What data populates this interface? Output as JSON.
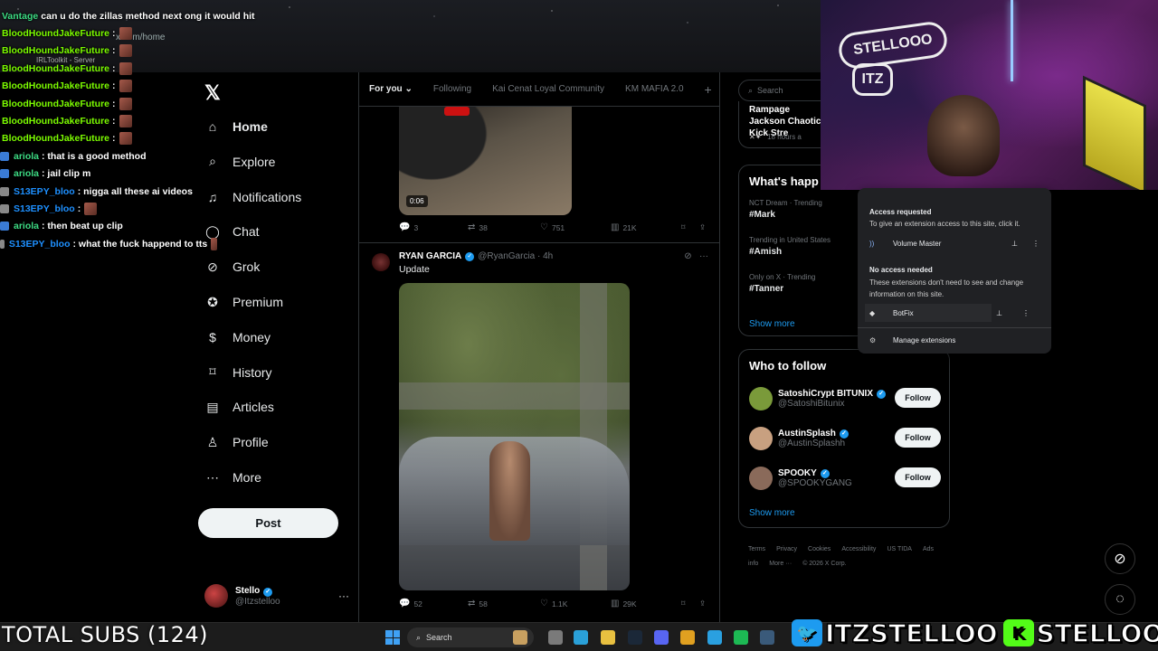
{
  "browser": {
    "url": "x.com/home",
    "bookmark": "IRLToolkit - Server"
  },
  "chat": [
    {
      "user": "Vantage",
      "color": "#3ddc84",
      "message": "can u do the zillas method next ong it would hit",
      "badge": "",
      "emote": false
    },
    {
      "user": "BloodHoundJakeFuture",
      "color": "#7cfc00",
      "message": ":",
      "badge": "",
      "emote": true
    },
    {
      "user": "BloodHoundJakeFuture",
      "color": "#7cfc00",
      "message": ":",
      "badge": "",
      "emote": true
    },
    {
      "user": "BloodHoundJakeFuture",
      "color": "#7cfc00",
      "message": ":",
      "badge": "",
      "emote": true
    },
    {
      "user": "BloodHoundJakeFuture",
      "color": "#7cfc00",
      "message": ":",
      "badge": "",
      "emote": true
    },
    {
      "user": "BloodHoundJakeFuture",
      "color": "#7cfc00",
      "message": ":",
      "badge": "",
      "emote": true
    },
    {
      "user": "BloodHoundJakeFuture",
      "color": "#7cfc00",
      "message": ":",
      "badge": "",
      "emote": true
    },
    {
      "user": "BloodHoundJakeFuture",
      "color": "#7cfc00",
      "message": ":",
      "badge": "",
      "emote": true
    },
    {
      "user": "ariola",
      "color": "#3ddc84",
      "message": ": that is a good method",
      "badge": "#3a7bd5",
      "emote": false
    },
    {
      "user": "ariola",
      "color": "#3ddc84",
      "message": ": jail clip m",
      "badge": "#3a7bd5",
      "emote": false
    },
    {
      "user": "S13EPY_bloo",
      "color": "#1e90ff",
      "message": ": nigga all these ai videos",
      "badge": "#888",
      "emote": false
    },
    {
      "user": "S13EPY_bloo",
      "color": "#1e90ff",
      "message": ":",
      "badge": "#888",
      "emote": true
    },
    {
      "user": "ariola",
      "color": "#3ddc84",
      "message": ": then beat up clip",
      "badge": "#3a7bd5",
      "emote": false
    },
    {
      "user": "S13EPY_bloo",
      "color": "#1e90ff",
      "message": ": what the fuck happend to tts",
      "badge": "#888",
      "emote": true
    }
  ],
  "nav": {
    "items": [
      {
        "label": "Home",
        "icon": "home-icon"
      },
      {
        "label": "Explore",
        "icon": "search-icon"
      },
      {
        "label": "Notifications",
        "icon": "bell-icon"
      },
      {
        "label": "Chat",
        "icon": "chat-icon"
      },
      {
        "label": "Grok",
        "icon": "grok-icon"
      },
      {
        "label": "Premium",
        "icon": "premium-icon"
      },
      {
        "label": "Money",
        "icon": "money-icon"
      },
      {
        "label": "History",
        "icon": "bookmark-icon"
      },
      {
        "label": "Articles",
        "icon": "articles-icon"
      },
      {
        "label": "Profile",
        "icon": "profile-icon"
      },
      {
        "label": "More",
        "icon": "more-icon"
      }
    ],
    "post_label": "Post",
    "profile": {
      "name": "Stello",
      "handle": "@Itzstelloo"
    }
  },
  "timeline": {
    "tabs": [
      "For you",
      "Following",
      "Kai Cenat Loyal Community",
      "KM MAFIA 2.0"
    ],
    "tweet1": {
      "duration": "0:06",
      "replies": "3",
      "reposts": "38",
      "likes": "751",
      "views": "21K"
    },
    "tweet2": {
      "name": "RYAN GARCIA",
      "handle": "@RyanGarcia · 4h",
      "text": "Update",
      "replies": "52",
      "reposts": "58",
      "likes": "1.1K",
      "views": "29K"
    }
  },
  "right": {
    "search_placeholder": "Search",
    "live": {
      "title": "Rampage Jackson Chaotic Kick Stre",
      "meta": "18 hours a"
    },
    "trends_title": "What's happ",
    "trends": [
      {
        "meta": "NCT Dream · Trending",
        "name": "#Mark"
      },
      {
        "meta": "Trending in United States",
        "name": "#Amish"
      },
      {
        "meta": "Only on X · Trending",
        "name": "#Tanner"
      }
    ],
    "show_more": "Show more",
    "who_title": "Who to follow",
    "follows": [
      {
        "name": "SatoshiCrypt BITUNIX",
        "handle": "@SatoshiBitunix",
        "avatar": "#7a9a3a"
      },
      {
        "name": "AustinSplash",
        "handle": "@AustinSplashh",
        "avatar": "#c8a080"
      },
      {
        "name": "SPOOKY",
        "handle": "@SPOOKYGANG",
        "avatar": "#8a6a5a"
      }
    ],
    "follow_label": "Follow",
    "footer": [
      "Terms",
      "Privacy",
      "Cookies",
      "Accessibility",
      "US TIDA",
      "Ads info",
      "More ···",
      "© 2026 X Corp."
    ]
  },
  "extensions": {
    "h1": "Access requested",
    "t1": "To give an extension access to this site, click it.",
    "ext1": "Volume Master",
    "h2": "No access needed",
    "t2": "These extensions don't need to see and change information on this site.",
    "ext2": "BotFix",
    "manage": "Manage extensions"
  },
  "cam": {
    "sign": "STELLOOO",
    "sign2": "ITZ"
  },
  "taskbar": {
    "search": "Search"
  },
  "overlay": {
    "subs": "TOTAL SUBS (124)",
    "twitter": "ITZSTELLOO",
    "kick": "STELLOOO"
  }
}
